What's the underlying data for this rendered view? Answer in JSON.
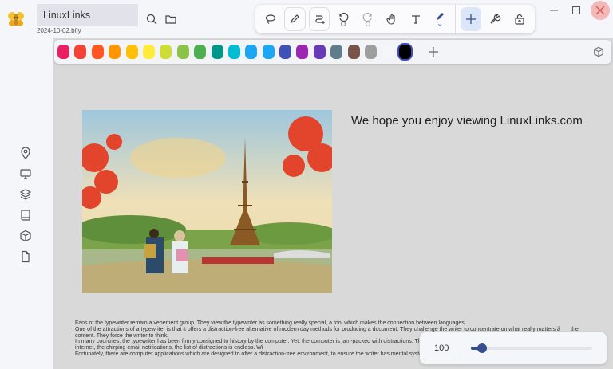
{
  "app": {
    "document_title": "LinuxLinks",
    "file_name": "2024-10-02.bfly"
  },
  "toolbar": {
    "tools": [
      "lasso",
      "pen",
      "stroke",
      "undo",
      "redo",
      "hand",
      "text",
      "marker",
      "add",
      "wrench",
      "lock"
    ]
  },
  "palette": {
    "colors": [
      "#e91e63",
      "#f44336",
      "#ff5722",
      "#ff9800",
      "#ffc107",
      "#ffeb3b",
      "#cddc39",
      "#8bc34a",
      "#4caf50",
      "#009688",
      "#00bcd4",
      "#1ea5f3",
      "#1ea5f3",
      "#3f51b5",
      "#9c27b0",
      "#673ab7",
      "#607d8b",
      "#795548",
      "#9e9e9e",
      "#f5f6fa",
      "#000000"
    ],
    "selected": "#000000"
  },
  "canvas": {
    "heading": "We hope you enjoy viewing LinuxLinks.com",
    "paragraphs": [
      "Fans of the typewriter remain a vehement group. They view the typewriter as something really special, a tool which makes the connection between languages.",
      "One of the attractions of a typewriter is that it offers a distraction-free alternative of modern day methods for producing a document. They challenge the writer to concentrate on what really matters â the content. They force the writer to think.",
      "In many countries, the typewriter has been firmly consigned to history by the computer. Yet, the computer is jam-packed with distractions. The chatter of social media, the almost limitless content of the internet, the chirping email notifications, the list of distractions is endless. Wi",
      "Fortunately, there are computer applications which are designed to offer a distraction-free environment, to ensure the writer has mental system and a cluttered interface."
    ]
  },
  "zoom": {
    "value": "100",
    "slider_fraction": 0.05
  }
}
